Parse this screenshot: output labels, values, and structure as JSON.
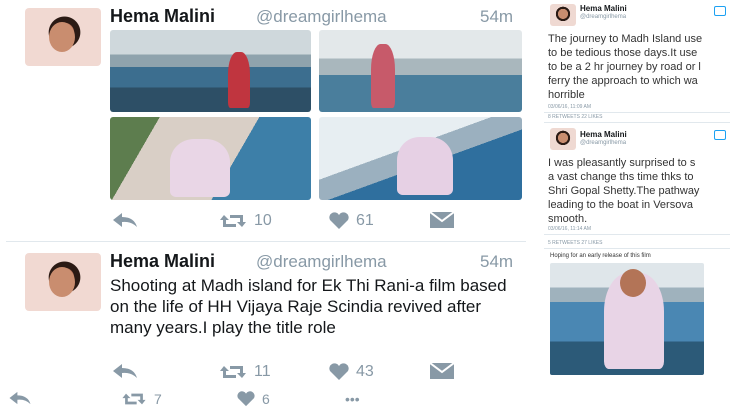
{
  "tweet1": {
    "name": "Hema Malini",
    "handle": "@dreamgirlhema",
    "time": "54m",
    "retweets": "10",
    "likes": "61"
  },
  "tweet2": {
    "name": "Hema Malini",
    "handle": "@dreamgirlhema",
    "time": "54m",
    "text": "Shooting at Madh island for Ek Thi Rani-a film based on the life of HH Vijaya Raje Scindia revived after many years.I play the title role",
    "retweets": "11",
    "likes": "43"
  },
  "tweet3": {
    "retweets": "7",
    "likes": "6",
    "more": "•••"
  },
  "side": {
    "card1": {
      "name": "Hema Malini",
      "handle": "@dreamgirlhema",
      "lines": [
        "The journey to Madh Island use",
        "to be tedious those days.It use",
        "to be a 2 hr journey by road or l",
        "ferry the approach to which wa",
        "horrible"
      ],
      "date": "03/06/16, 11:09 AM",
      "stats": "8 RETWEETS 22 LIKES"
    },
    "card2": {
      "name": "Hema Malini",
      "handle": "@dreamgirlhema",
      "lines": [
        "I was pleasantly surprised to s",
        "a vast change ths time thks to",
        "Shri Gopal Shetty.The pathway",
        "leading to the boat in Versova",
        "smooth."
      ],
      "date": "03/06/16, 11:14 AM",
      "stats": "5 RETWEETS 27 LIKES"
    },
    "card3": {
      "caption": "Hoping for an early release of this film"
    }
  },
  "colors": {
    "text": "#14171a",
    "muted": "#8899a6",
    "divider": "#e1e8ed",
    "accent": "#1da1f2"
  }
}
